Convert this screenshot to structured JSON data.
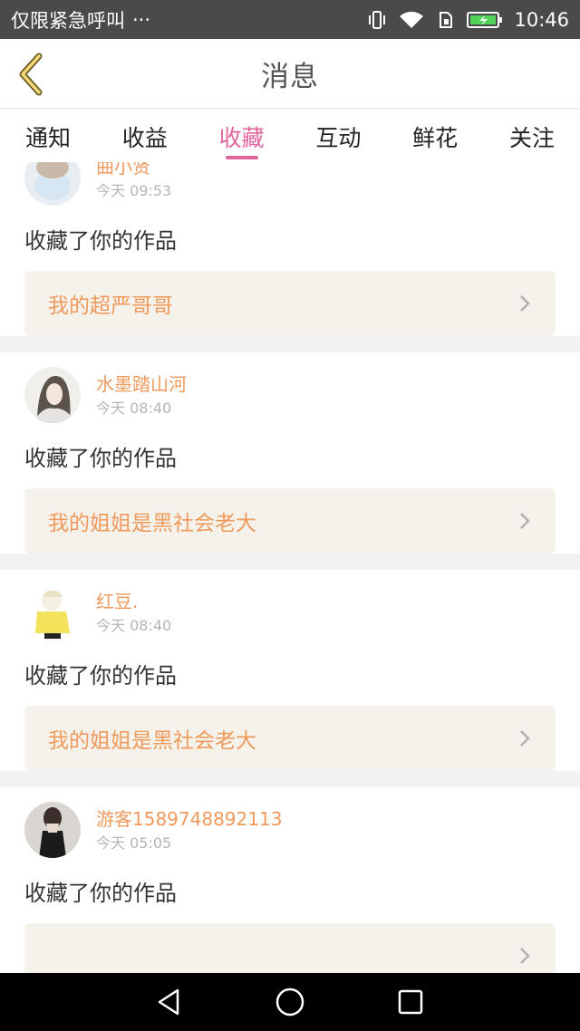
{
  "status_bar": {
    "left_text": "仅限紧急呼叫",
    "more": "···",
    "time": "10:46"
  },
  "header": {
    "title": "消息",
    "back_icon": "chevron-left-icon"
  },
  "tabs": [
    {
      "label": "通知",
      "active": false
    },
    {
      "label": "收益",
      "active": false
    },
    {
      "label": "收藏",
      "active": true
    },
    {
      "label": "互动",
      "active": false
    },
    {
      "label": "鲜花",
      "active": false
    },
    {
      "label": "关注",
      "active": false
    }
  ],
  "cards": [
    {
      "user": "曲小贤",
      "time": "今天 09:53",
      "action": "收藏了你的作品",
      "work": "我的超严哥哥"
    },
    {
      "user": "水墨踏山河",
      "time": "今天 08:40",
      "action": "收藏了你的作品",
      "work": "我的姐姐是黑社会老大"
    },
    {
      "user": "红豆.",
      "time": "今天 08:40",
      "action": "收藏了你的作品",
      "work": "我的姐姐是黑社会老大"
    },
    {
      "user": "游客1589748892113",
      "time": "今天 05:05",
      "action": "收藏了你的作品",
      "work": ""
    }
  ],
  "colors": {
    "accent": "#e0659c",
    "name": "#ef9a5c",
    "work_bg": "#f4f2ea"
  }
}
